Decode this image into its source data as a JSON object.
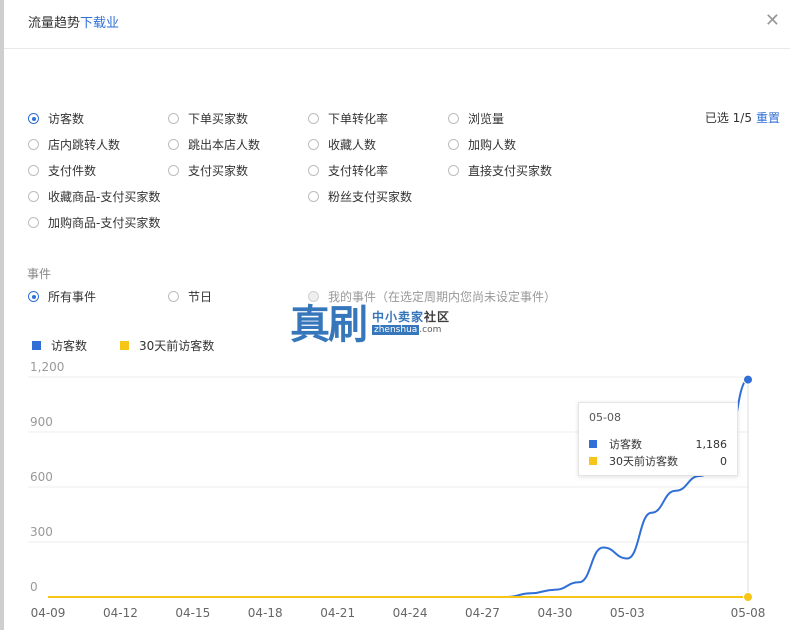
{
  "dialog": {
    "title_prefix": "流量趋势",
    "title_link": "下载",
    "title_suffix": "业",
    "close_glyph": "✕"
  },
  "metrics": {
    "selected_count": "已选 1/5",
    "reset_label": "重置",
    "options": [
      {
        "label": "访客数",
        "checked": true
      },
      {
        "label": "下单买家数",
        "checked": false
      },
      {
        "label": "下单转化率",
        "checked": false
      },
      {
        "label": "浏览量",
        "checked": false
      },
      {
        "label": "店内跳转人数",
        "checked": false
      },
      {
        "label": "跳出本店人数",
        "checked": false
      },
      {
        "label": "收藏人数",
        "checked": false
      },
      {
        "label": "加购人数",
        "checked": false
      },
      {
        "label": "支付件数",
        "checked": false
      },
      {
        "label": "支付买家数",
        "checked": false
      },
      {
        "label": "支付转化率",
        "checked": false
      },
      {
        "label": "直接支付买家数",
        "checked": false
      },
      {
        "label": "收藏商品-支付买家数",
        "checked": false
      },
      {
        "label": "粉丝支付买家数",
        "checked": false
      },
      {
        "label": "加购商品-支付买家数",
        "checked": false
      }
    ]
  },
  "events": {
    "label": "事件",
    "options": [
      {
        "label": "所有事件",
        "checked": true
      },
      {
        "label": "节日",
        "checked": false
      },
      {
        "label": "我的事件（在选定周期内您尚未设定事件）",
        "checked": false,
        "disabled": true
      }
    ]
  },
  "watermark": {
    "big": "真刷",
    "top_a": "中小卖家",
    "top_b": "社区",
    "bot_a": "zhenshua",
    "bot_b": ".com"
  },
  "chart_data": {
    "type": "line",
    "x": [
      "04-09",
      "04-10",
      "04-11",
      "04-12",
      "04-13",
      "04-14",
      "04-15",
      "04-16",
      "04-17",
      "04-18",
      "04-19",
      "04-20",
      "04-21",
      "04-22",
      "04-23",
      "04-24",
      "04-25",
      "04-26",
      "04-27",
      "04-28",
      "04-29",
      "04-30",
      "05-01",
      "05-02",
      "05-03",
      "05-04",
      "05-05",
      "05-06",
      "05-07",
      "05-08"
    ],
    "x_tick_labels": [
      "04-09",
      "04-12",
      "04-15",
      "04-18",
      "04-21",
      "04-24",
      "04-27",
      "04-30",
      "05-03",
      "05-08"
    ],
    "ylim": [
      0,
      1200
    ],
    "y_ticks": [
      "0",
      "300",
      "600",
      "900",
      "1,200"
    ],
    "grid": true,
    "legend_position": "top-left",
    "series": [
      {
        "name": "访客数",
        "color": "#2f6fd6",
        "values": [
          0,
          0,
          0,
          0,
          0,
          0,
          0,
          0,
          0,
          0,
          0,
          0,
          0,
          0,
          0,
          0,
          0,
          0,
          0,
          0,
          20,
          40,
          80,
          270,
          210,
          460,
          580,
          660,
          760,
          1186
        ]
      },
      {
        "name": "30天前访客数",
        "color": "#f5c518",
        "values": [
          0,
          0,
          0,
          0,
          0,
          0,
          0,
          0,
          0,
          0,
          0,
          0,
          0,
          0,
          0,
          0,
          0,
          0,
          0,
          0,
          0,
          0,
          0,
          0,
          0,
          0,
          0,
          0,
          0,
          0
        ]
      }
    ],
    "tooltip": {
      "date": "05-08",
      "rows": [
        {
          "name": "访客数",
          "value": "1,186",
          "color": "#2f6fd6"
        },
        {
          "name": "30天前访客数",
          "value": "0",
          "color": "#f5c518"
        }
      ]
    }
  }
}
